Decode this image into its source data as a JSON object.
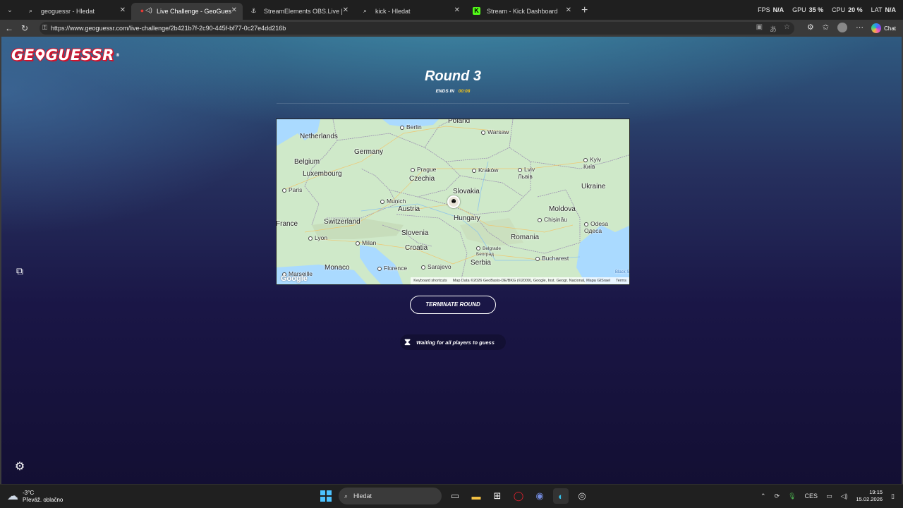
{
  "browser": {
    "tabs": [
      {
        "title": "geoguessr - Hledat",
        "active": false
      },
      {
        "title": "Live Challenge - GeoGuessr",
        "active": true
      },
      {
        "title": "StreamElements OBS.Live | Stream",
        "active": false
      },
      {
        "title": "kick - Hledat",
        "active": false
      },
      {
        "title": "Stream - Kick Dashboard",
        "active": false
      }
    ],
    "url": "https://www.geoguessr.com/live-challenge/2b421b7f-2c90-445f-bf77-0c27e4dd216b",
    "perf": {
      "fps_label": "FPS",
      "fps_value": "N/A",
      "gpu_label": "GPU",
      "gpu_value": "35 %",
      "cpu_label": "CPU",
      "cpu_value": "20 %",
      "lat_label": "LAT",
      "lat_value": "N/A"
    },
    "chat_label": "Chat"
  },
  "page": {
    "logo": "GE GUESSR",
    "round_title": "Round 3",
    "ends_label": "ENDS IN",
    "ends_time": "00:08",
    "terminate_label": "TERMINATE ROUND",
    "waiting_text": "Waiting for all players to guess"
  },
  "map": {
    "countries": [
      "Poland",
      "Netherlands",
      "Germany",
      "Belgium",
      "Luxembourg",
      "Czechia",
      "Slovakia",
      "Ukraine",
      "Austria",
      "Moldova",
      "France",
      "Switzerland",
      "Hungary",
      "Slovenia",
      "Romania",
      "Croatia",
      "Monaco",
      "Serbia"
    ],
    "cities": [
      "Berlin",
      "Warsaw",
      "Prague",
      "Kraków",
      "Lviv\nЛьвів",
      "Kyiv\nКиїв",
      "Paris",
      "Munich",
      "Chișinău",
      "Odesa\nОдеса",
      "Lyon",
      "Milan",
      "Belgrade\nБеоград",
      "Florence",
      "Sarajevo",
      "Bucharest",
      "Marseille"
    ],
    "google": "Google",
    "footer": {
      "shortcuts": "Keyboard shortcuts",
      "attribution": "Map Data ©2026 GeoBasis-DE/BKG (©2009), Google, Inst. Geogr. Nacional, Mapa GISrael",
      "terms": "Terms"
    },
    "sea_label": "Black S"
  },
  "taskbar": {
    "temperature": "-3°C",
    "weather": "Převáž. oblačno",
    "search_placeholder": "Hledat",
    "language": "CES",
    "time": "19:15",
    "date": "15.02.2026"
  }
}
